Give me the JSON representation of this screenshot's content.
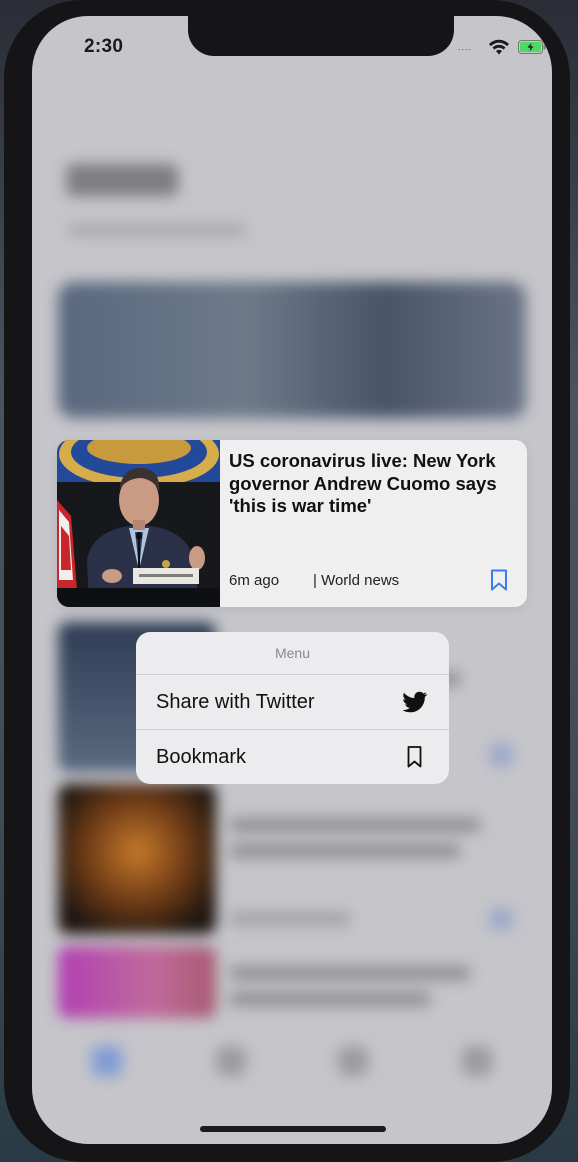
{
  "status_bar": {
    "time": "2:30",
    "dots": "....",
    "wifi_icon": "wifi-icon",
    "battery_icon": "battery-charging-icon"
  },
  "article": {
    "headline": "US coronavirus live: New York governor Andrew Cuomo says 'this is war time'",
    "time_ago": "6m ago",
    "section": "| World news",
    "bookmark_icon": "bookmark-icon",
    "accent_color": "#3b7cf5"
  },
  "context_menu": {
    "header": "Menu",
    "items": [
      {
        "label": "Share with Twitter",
        "icon": "twitter-icon"
      },
      {
        "label": "Bookmark",
        "icon": "bookmark-icon"
      }
    ]
  }
}
